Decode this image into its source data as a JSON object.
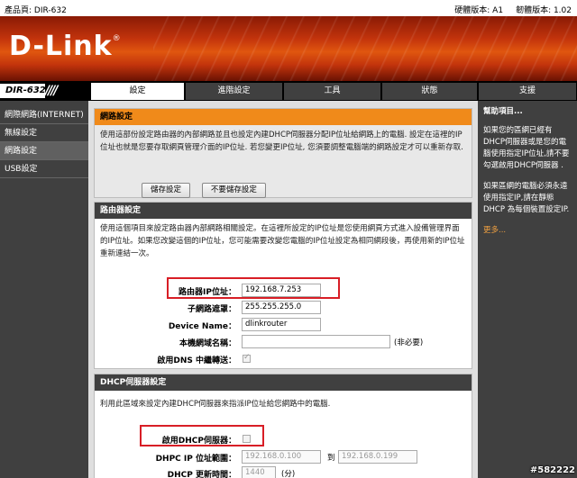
{
  "topbar": {
    "product": "產品頁: DIR-632",
    "hw_version": "硬體版本: A1",
    "fw_version": "韌體版本: 1.02"
  },
  "logo": "D-Link",
  "model": "DIR-632",
  "tabs": [
    {
      "label": "設定"
    },
    {
      "label": "進階設定"
    },
    {
      "label": "工具"
    },
    {
      "label": "狀態"
    },
    {
      "label": "支援"
    }
  ],
  "sidebar": {
    "items": [
      {
        "label": "網際網路(INTERNET)"
      },
      {
        "label": "無線設定"
      },
      {
        "label": "網路設定"
      },
      {
        "label": "USB設定"
      }
    ]
  },
  "network_settings": {
    "title": "網路設定",
    "description": "使用這部份設定路由器的內部網路並且也設定內建DHCP伺服器分配IP位址給網路上的電腦. 設定在這裡的IP位址也就是您要存取網頁管理介面的IP位址. 若您變更IP位址, 您須要調整電腦端的網路設定才可以重新存取.",
    "save_button": "儲存設定",
    "dont_save_button": "不要儲存設定"
  },
  "router_settings": {
    "title": "路由器設定",
    "description": "使用這個項目來設定路由器內部網路相關設定。在這裡所設定的IP位址是您使用網頁方式進入設備管理界面的IP位址。如果您改變這個的IP位址，您可能需要改變您電腦的IP位址設定為相同網段後，再使用新的IP位址重新連結一次。",
    "router_ip_label": "路由器IP位址：",
    "router_ip_value": "192.168.7.253",
    "subnet_label": "子網路遮罩：",
    "subnet_value": "255.255.255.0",
    "device_name_label": "Device Name：",
    "device_name_value": "dlinkrouter",
    "domain_label": "本機網域名稱：",
    "domain_value": "",
    "domain_note": "(非必要)",
    "dns_relay_label": "啟用DNS 中繼轉送："
  },
  "dhcp_settings": {
    "title": "DHCP伺服器設定",
    "description": "利用此區域來設定內建DHCP伺服器來指派IP位址給您網路中的電腦.",
    "enable_label": "啟用DHCP伺服器：",
    "range_label": "DHPC IP 位址範圍：",
    "range_start": "192.168.0.100",
    "range_to": "到",
    "range_end": "192.168.0.199",
    "lease_label": "DHCP 更新時間：",
    "lease_value": "1440",
    "lease_unit": "(分)"
  },
  "help": {
    "title": "幫助項目...",
    "para1": "如果您的區網已經有DHCP伺服器或是您的電腦使用指定IP位址,請不要勾選啟用DHCP伺服器 .",
    "para2": "如果區網的電腦必須永遠使用指定IP,請在靜態DHCP 為每個裝置設定IP.",
    "more": "更多..."
  },
  "watermark": "#582222"
}
